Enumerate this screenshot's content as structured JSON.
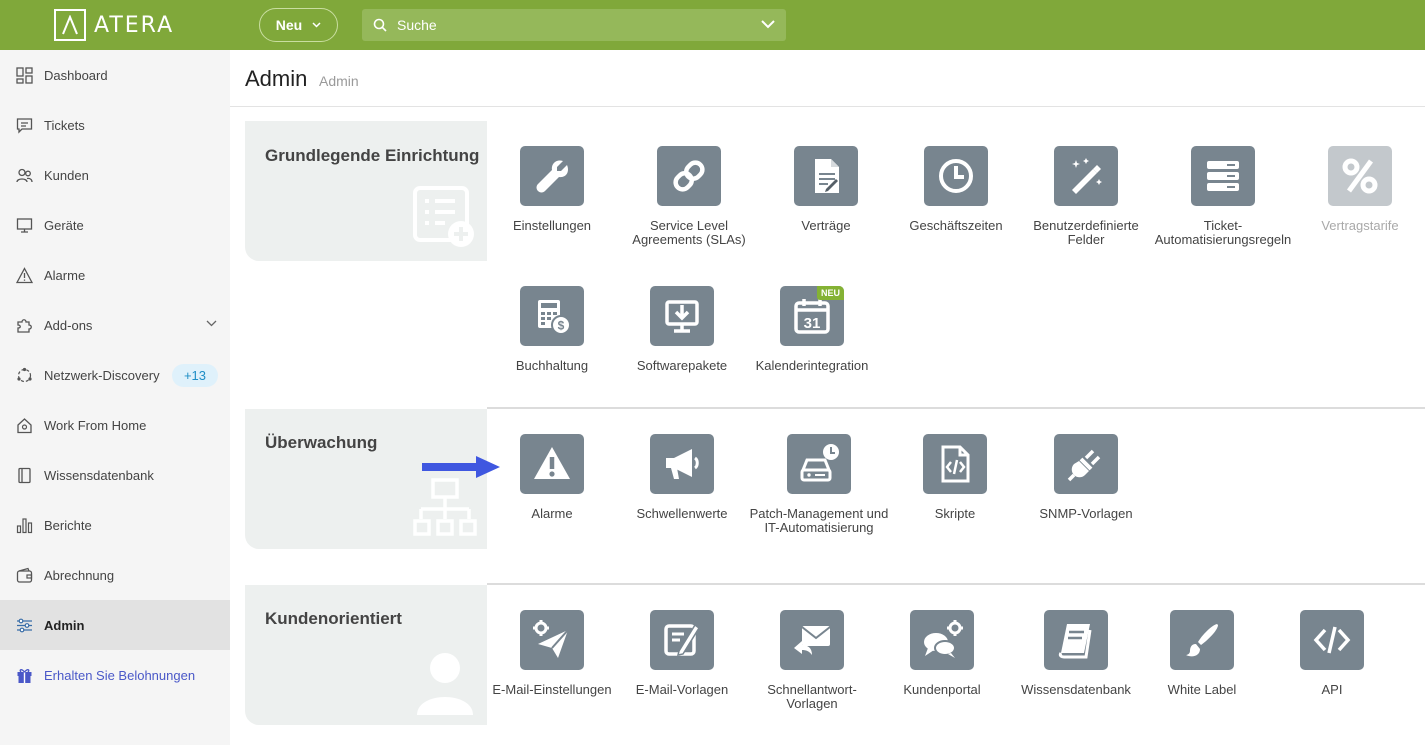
{
  "topbar": {
    "logo_text": "ATERA",
    "new_label": "Neu",
    "search_placeholder": "Suche"
  },
  "sidebar": {
    "items": [
      {
        "label": "Dashboard",
        "icon": "dashboard-icon"
      },
      {
        "label": "Tickets",
        "icon": "tickets-icon"
      },
      {
        "label": "Kunden",
        "icon": "customers-icon"
      },
      {
        "label": "Geräte",
        "icon": "devices-icon"
      },
      {
        "label": "Alarme",
        "icon": "alert-icon"
      },
      {
        "label": "Add-ons",
        "icon": "puzzle-icon"
      },
      {
        "label": "Netzwerk-Discovery",
        "icon": "network-icon",
        "badge": "+13"
      },
      {
        "label": "Work From Home",
        "icon": "home-icon"
      },
      {
        "label": "Wissensdatenbank",
        "icon": "book-icon"
      },
      {
        "label": "Berichte",
        "icon": "reports-icon"
      },
      {
        "label": "Abrechnung",
        "icon": "wallet-icon"
      },
      {
        "label": "Admin",
        "icon": "sliders-icon",
        "active": true
      },
      {
        "label": "Erhalten Sie Belohnungen",
        "icon": "gift-icon"
      }
    ]
  },
  "header": {
    "title": "Admin",
    "breadcrumb": "Admin"
  },
  "sections": [
    {
      "title": "Grundlegende Einrichtung",
      "tiles": [
        {
          "label": "Einstellungen",
          "icon": "wrench-icon"
        },
        {
          "label": "Service Level Agreements (SLAs)",
          "icon": "link-icon"
        },
        {
          "label": "Verträge",
          "icon": "contract-icon"
        },
        {
          "label": "Geschäftszeiten",
          "icon": "clock-icon"
        },
        {
          "label": "Benutzerdefinierte Felder",
          "icon": "magic-wand-icon"
        },
        {
          "label": "Ticket-Automatisierungsregeln",
          "icon": "server-rules-icon"
        },
        {
          "label": "Vertragstarife",
          "icon": "percent-icon",
          "disabled": true
        },
        {
          "label": "Buchhaltung",
          "icon": "calculator-icon"
        },
        {
          "label": "Softwarepakete",
          "icon": "software-download-icon"
        },
        {
          "label": "Kalenderintegration",
          "icon": "calendar-icon",
          "badge": "NEU",
          "calendar_day": "31"
        }
      ]
    },
    {
      "title": "Überwachung",
      "tiles": [
        {
          "label": "Alarme",
          "icon": "warning-icon"
        },
        {
          "label": "Schwellenwerte",
          "icon": "megaphone-icon"
        },
        {
          "label": "Patch-Management und IT-Automatisierung",
          "icon": "patch-drive-icon"
        },
        {
          "label": "Skripte",
          "icon": "script-file-icon"
        },
        {
          "label": "SNMP-Vorlagen",
          "icon": "plug-icon"
        }
      ]
    },
    {
      "title": "Kundenorientiert",
      "tiles": [
        {
          "label": "E-Mail-Einstellungen",
          "icon": "mail-settings-icon"
        },
        {
          "label": "E-Mail-Vorlagen",
          "icon": "mail-templates-icon"
        },
        {
          "label": "Schnellantwort-Vorlagen",
          "icon": "quick-reply-icon"
        },
        {
          "label": "Kundenportal",
          "icon": "customer-portal-icon"
        },
        {
          "label": "Wissensdatenbank",
          "icon": "knowledge-base-icon"
        },
        {
          "label": "White Label",
          "icon": "brush-icon"
        },
        {
          "label": "API",
          "icon": "code-icon"
        }
      ]
    }
  ],
  "colors": {
    "topbar": "#80a83a",
    "tile": "#78858f",
    "tile_disabled": "#c3c8cc",
    "badge_new": "#84b234",
    "arrow": "#3f57e0"
  }
}
